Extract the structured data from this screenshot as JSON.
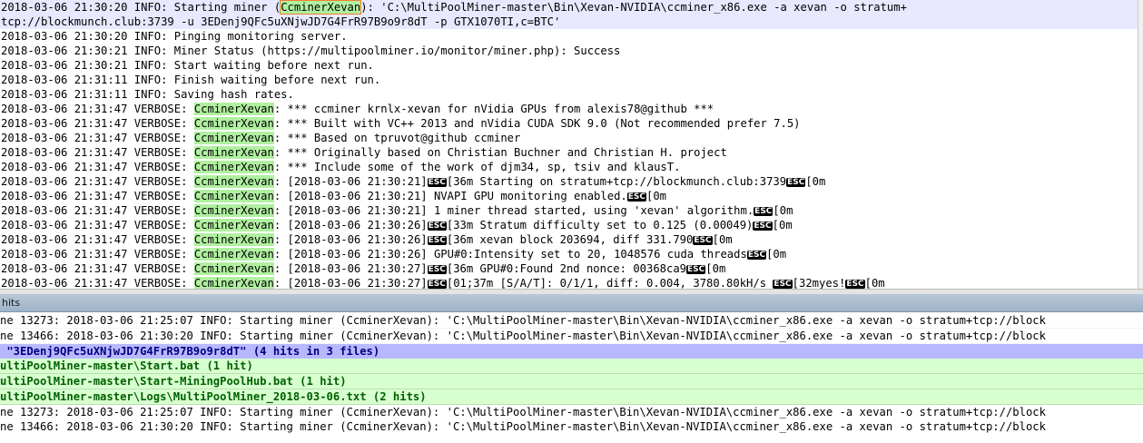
{
  "editor": {
    "lines": [
      {
        "pre": "2018-03-06 21:30:20 INFO: Starting miner (",
        "hl": "CcminerXevan",
        "post": "): 'C:\\MultiPoolMiner-master\\Bin\\Xevan-NVIDIA\\ccminer_x86.exe -a xevan -o stratum+"
      },
      {
        "pre": "tcp://blockmunch.club:3739",
        "hl": "",
        "post": " -u 3EDenj9QFc5uXNjwJD7G4FrR97B9o9r8dT -p GTX1070TI,c=BTC'"
      },
      {
        "pre": "2018-03-06 21:30:20 INFO: Pinging monitoring server.",
        "hl": "",
        "post": ""
      },
      {
        "pre": "2018-03-06 21:30:21 INFO: Miner Status (",
        "hl": "",
        "post": "https://multipoolminer.io/monitor/miner.php): Success"
      },
      {
        "pre": "2018-03-06 21:30:21 INFO: Start waiting before next run.",
        "hl": "",
        "post": ""
      },
      {
        "pre": "2018-03-06 21:31:11 INFO: Finish waiting before next run.",
        "hl": "",
        "post": ""
      },
      {
        "pre": "2018-03-06 21:31:11 INFO: Saving hash rates.",
        "hl": "",
        "post": ""
      },
      {
        "pre": "2018-03-06 21:31:47 VERBOSE: ",
        "hl": "CcminerXevan",
        "post": ": *** ccminer krnlx-xevan for nVidia GPUs from alexis78@github ***"
      },
      {
        "pre": "2018-03-06 21:31:47 VERBOSE: ",
        "hl": "CcminerXevan",
        "post": ": *** Built with VC++ 2013 and nVidia CUDA SDK 9.0 (Not recommended prefer 7.5)"
      },
      {
        "pre": "2018-03-06 21:31:47 VERBOSE: ",
        "hl": "CcminerXevan",
        "post": ": *** Based on tpruvot@github ccminer"
      },
      {
        "pre": "2018-03-06 21:31:47 VERBOSE: ",
        "hl": "CcminerXevan",
        "post": ": *** Originally based on Christian Buchner and Christian H. project"
      },
      {
        "pre": "2018-03-06 21:31:47 VERBOSE: ",
        "hl": "CcminerXevan",
        "post": ": *** Include some of the work of djm34, sp, tsiv and klausT."
      },
      {
        "pre": "2018-03-06 21:31:47 VERBOSE: ",
        "hl": "CcminerXevan",
        "post": ": [2018-03-06 21:30:21]{ESC}[36m Starting on stratum+tcp://blockmunch.club:3739{ESC}[0m"
      },
      {
        "pre": "2018-03-06 21:31:47 VERBOSE: ",
        "hl": "CcminerXevan",
        "post": ": [2018-03-06 21:30:21] NVAPI GPU monitoring enabled.{ESC}[0m"
      },
      {
        "pre": "2018-03-06 21:31:47 VERBOSE: ",
        "hl": "CcminerXevan",
        "post": ": [2018-03-06 21:30:21] 1 miner thread started, using 'xevan' algorithm.{ESC}[0m"
      },
      {
        "pre": "2018-03-06 21:31:47 VERBOSE: ",
        "hl": "CcminerXevan",
        "post": ": [2018-03-06 21:30:26]{ESC}[33m Stratum difficulty set to 0.125 (0.00049){ESC}[0m"
      },
      {
        "pre": "2018-03-06 21:31:47 VERBOSE: ",
        "hl": "CcminerXevan",
        "post": ": [2018-03-06 21:30:26]{ESC}[36m xevan block 203694, diff 331.790{ESC}[0m"
      },
      {
        "pre": "2018-03-06 21:31:47 VERBOSE: ",
        "hl": "CcminerXevan",
        "post": ": [2018-03-06 21:30:26] GPU#0:Intensity set to 20, 1048576 cuda threads{ESC}[0m"
      },
      {
        "pre": "2018-03-06 21:31:47 VERBOSE: ",
        "hl": "CcminerXevan",
        "post": ": [2018-03-06 21:30:27]{ESC}[36m GPU#0:Found 2nd nonce: 00368ca9{ESC}[0m"
      },
      {
        "pre": "2018-03-06 21:31:47 VERBOSE: ",
        "hl": "CcminerXevan",
        "post": ": [2018-03-06 21:30:27]{ESC}[01;37m [S/A/T]: 0/1/1, diff: 0.004, 3780.80kH/s {ESC}[32myes!{ESC}[0m"
      }
    ],
    "esc_label": "ESC"
  },
  "panel": {
    "title": "hits"
  },
  "results": [
    {
      "kind": "plain",
      "text": "ne 13273: 2018-03-06 21:25:07 INFO: Starting miner (CcminerXevan): 'C:\\MultiPoolMiner-master\\Bin\\Xevan-NVIDIA\\ccminer_x86.exe -a xevan -o stratum+tcp://block"
    },
    {
      "kind": "plain",
      "text": "ne 13466: 2018-03-06 21:30:20 INFO: Starting miner (CcminerXevan): 'C:\\MultiPoolMiner-master\\Bin\\Xevan-NVIDIA\\ccminer_x86.exe -a xevan -o stratum+tcp://block"
    },
    {
      "kind": "search",
      "text": " \"3EDenj9QFc5uXNjwJD7G4FrR97B9o9r8dT\" (4 hits in 3 files)"
    },
    {
      "kind": "file",
      "text": "ultiPoolMiner-master\\Start.bat (1 hit)"
    },
    {
      "kind": "file",
      "text": "ultiPoolMiner-master\\Start-MiningPoolHub.bat (1 hit)"
    },
    {
      "kind": "file",
      "text": "ultiPoolMiner-master\\Logs\\MultiPoolMiner_2018-03-06.txt (2 hits)"
    },
    {
      "kind": "hit",
      "text": "ne 13273: 2018-03-06 21:25:07 INFO: Starting miner (CcminerXevan): 'C:\\MultiPoolMiner-master\\Bin\\Xevan-NVIDIA\\ccminer_x86.exe -a xevan -o stratum+tcp://block"
    },
    {
      "kind": "hit",
      "text": "ne 13466: 2018-03-06 21:30:20 INFO: Starting miner (CcminerXevan): 'C:\\MultiPoolMiner-master\\Bin\\Xevan-NVIDIA\\ccminer_x86.exe -a xevan -o stratum+tcp://block"
    }
  ],
  "colors": {
    "highlight": "#b0f0a0",
    "search_row": "#b8b8ff",
    "file_row": "#d8ffd0"
  }
}
